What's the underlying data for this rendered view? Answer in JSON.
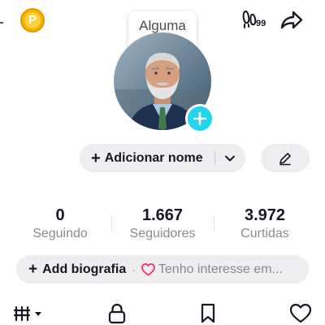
{
  "colors": {
    "accent_cyan": "#20d5ec",
    "coin_gold": "#f5b400",
    "pill_background": "#eeeef0",
    "muted_text": "#8a8b91",
    "heart_red": "#fe2c55"
  },
  "top_bar": {
    "coin_letter": "P",
    "tooltip_text": "Alguma ideia?",
    "badge_count": "99",
    "icons": [
      "coin-icon",
      "footprint-badge-icon",
      "share-icon"
    ]
  },
  "profile": {
    "avatar_icon": "profile-photo",
    "add_photo_icon": "plus-icon",
    "name_plus": "+",
    "name_label": "Adicionar nome"
  },
  "stats": [
    {
      "value": "0",
      "label": "Seguindo"
    },
    {
      "value": "1.667",
      "label": "Seguidores"
    },
    {
      "value": "3.972",
      "label": "Curtidas"
    }
  ],
  "bio": {
    "plus": "+",
    "label": "Add biografia",
    "separator": "·",
    "interest_text": "Tenho interesse em..."
  },
  "tabs": [
    {
      "icon": "grid-menu-icon"
    },
    {
      "icon": "lock-icon"
    },
    {
      "icon": "bookmark-icon"
    },
    {
      "icon": "heart-icon"
    }
  ]
}
